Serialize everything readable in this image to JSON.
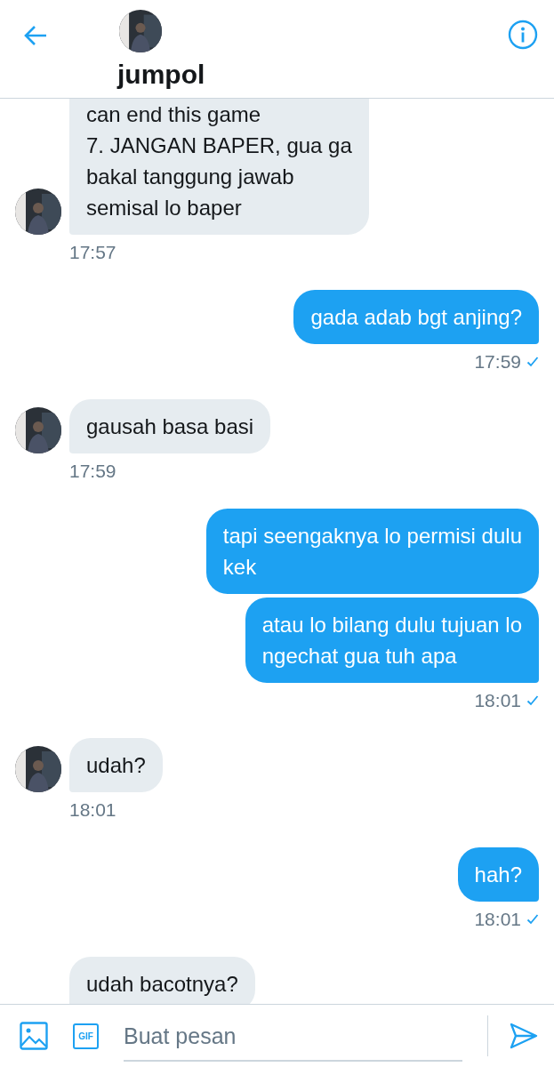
{
  "header": {
    "name": "jumpol"
  },
  "groups": [
    {
      "kind": "received",
      "avatar": true,
      "cut_top": true,
      "messages": [
        "can end this game\n7. JANGAN BAPER, gua ga\nbakal tanggung jawab\nsemisal lo baper"
      ],
      "time": "17:57"
    },
    {
      "kind": "sent",
      "read": true,
      "messages": [
        "gada adab bgt anjing?"
      ],
      "time": "17:59"
    },
    {
      "kind": "received",
      "avatar": true,
      "messages": [
        "gausah basa basi"
      ],
      "time": "17:59"
    },
    {
      "kind": "sent",
      "read": true,
      "messages": [
        "tapi seengaknya lo permisi dulu\nkek",
        "atau lo bilang dulu tujuan lo\nngechat gua tuh apa"
      ],
      "time": "18:01"
    },
    {
      "kind": "received",
      "avatar": true,
      "messages": [
        "udah?"
      ],
      "time": "18:01"
    },
    {
      "kind": "sent",
      "read": true,
      "messages": [
        "hah?"
      ],
      "time": "18:01"
    },
    {
      "kind": "received",
      "avatar": false,
      "messages": [
        "udah bacotnya?"
      ]
    }
  ],
  "composer": {
    "gif_label": "GIF",
    "placeholder": "Buat pesan"
  }
}
